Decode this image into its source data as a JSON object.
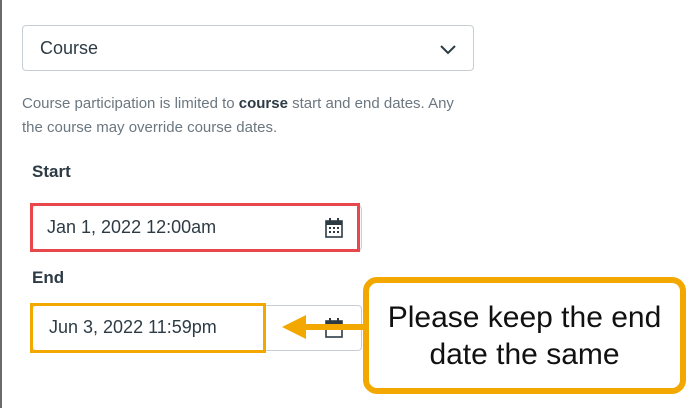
{
  "select": {
    "value": "Course",
    "icon": "chevron-down-icon"
  },
  "help": {
    "prefix": "Course participation is limited to ",
    "bold": "course",
    "suffix": " start and end dates. Any",
    "line2": "the course may override course dates."
  },
  "start": {
    "label": "Start",
    "value": "Jan 1, 2022 12:00am",
    "icon": "calendar-icon"
  },
  "end": {
    "label": "End",
    "value": "Jun 3, 2022 11:59pm",
    "icon": "calendar-icon"
  },
  "annotation": {
    "text": "Please keep the end date the same",
    "border_color": "#f3a800",
    "start_highlight_color": "#e8474b",
    "end_highlight_color": "#f3a800"
  }
}
